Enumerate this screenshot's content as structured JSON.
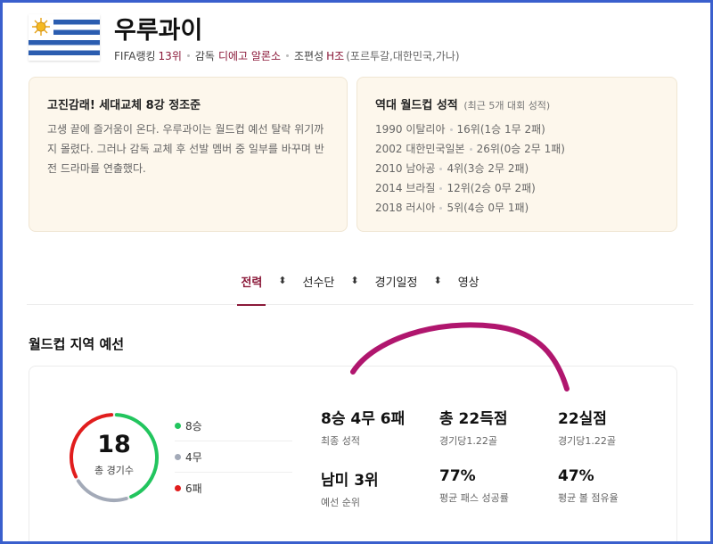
{
  "header": {
    "team_name": "우루과이",
    "fifa_label": "FIFA랭킹",
    "fifa_rank": "13위",
    "coach_label": "감독",
    "coach_name": "디에고 알론소",
    "group_label": "조편성",
    "group_name": "H조",
    "group_members": "(포르투갈,대한민국,가나)"
  },
  "summary_card": {
    "title": "고진감래! 세대교체 8강 정조준",
    "body": "고생 끝에 즐거움이 온다. 우루과이는 월드컵 예선 탈락 위기까지 몰렸다. 그러나 감독 교체 후 선발 멤버 중 일부를 바꾸며 반전 드라마를 연출했다."
  },
  "history_card": {
    "title": "역대 월드컵 성적",
    "subtitle": "(최근 5개 대회 성적)",
    "records": [
      {
        "event": "1990 이탈리아",
        "result": "16위(1승 1무 2패)"
      },
      {
        "event": "2002 대한민국일본",
        "result": "26위(0승 2무 1패)"
      },
      {
        "event": "2010 남아공",
        "result": "4위(3승 2무 2패)"
      },
      {
        "event": "2014 브라질",
        "result": "12위(2승 0무 2패)"
      },
      {
        "event": "2018 러시아",
        "result": "5위(4승 0무 1패)"
      }
    ]
  },
  "tabs": [
    {
      "label": "전력",
      "active": true
    },
    {
      "label": "선수단",
      "active": false
    },
    {
      "label": "경기일정",
      "active": false
    },
    {
      "label": "영상",
      "active": false
    }
  ],
  "section": {
    "title": "월드컵 지역 예선",
    "total_games": "18",
    "total_games_label": "총 경기수",
    "wins": 8,
    "draws": 4,
    "losses": 6,
    "legend": [
      {
        "label": "8승",
        "color": "#22c55e"
      },
      {
        "label": "4무",
        "color": "#a3aab8"
      },
      {
        "label": "6패",
        "color": "#e11d1d"
      }
    ],
    "stats": [
      {
        "value": "8승 4무 6패",
        "label": "최종 성적"
      },
      {
        "value": "총 22득점",
        "label": "경기당1.22골"
      },
      {
        "value": "22실점",
        "label": "경기당1.22골"
      },
      {
        "value": "남미 3위",
        "label": "예선 순위"
      },
      {
        "value": "77%",
        "label": "평균 패스 성공률"
      },
      {
        "value": "47%",
        "label": "평균 볼 점유율"
      }
    ]
  },
  "colors": {
    "accent": "#8b1a3a",
    "card_bg": "#fdf7ec",
    "frame": "#3a5fcd",
    "scribble": "#b0166e"
  }
}
